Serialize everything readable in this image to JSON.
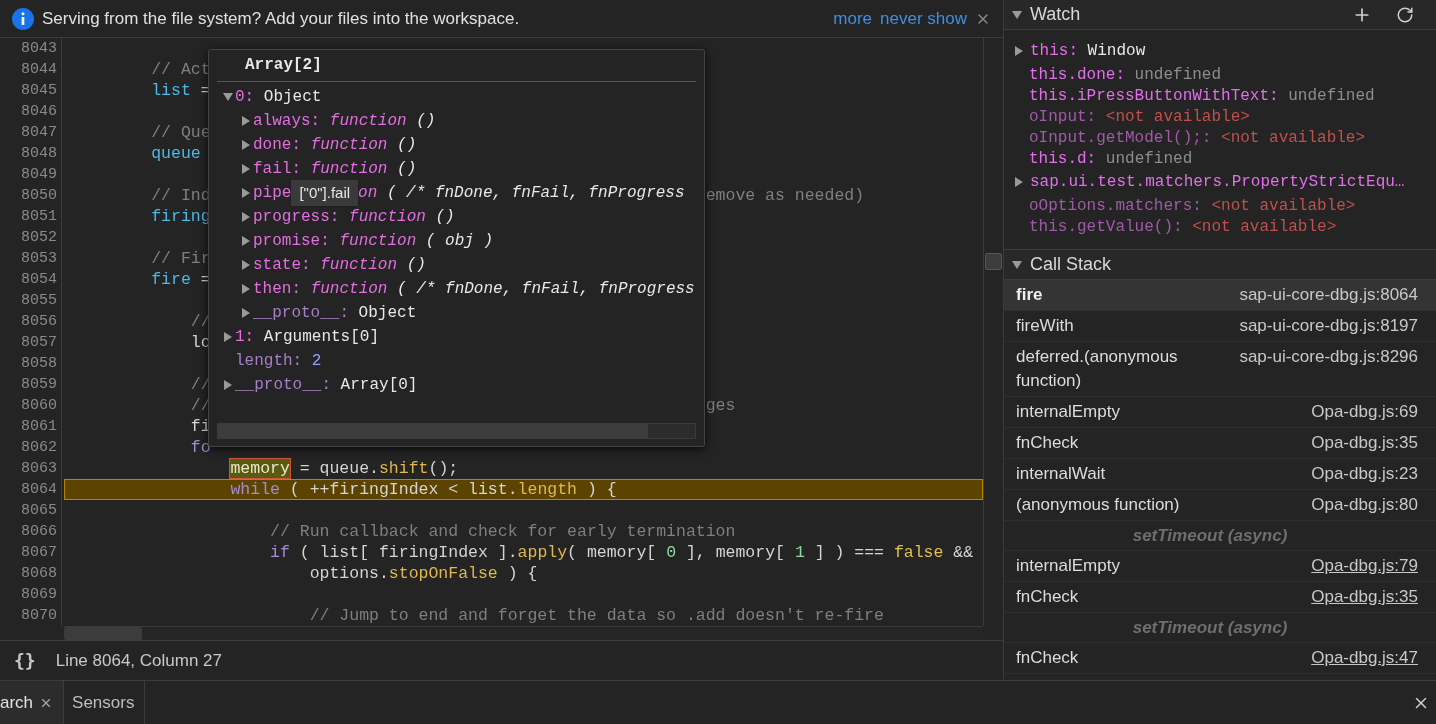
{
  "banner": {
    "message": "Serving from the file system? Add your files into the workspace.",
    "links": [
      "more",
      "never show"
    ]
  },
  "editor": {
    "lines": [
      {
        "number": "8043",
        "current": false
      },
      {
        "number": "8044",
        "current": false,
        "parts": [
          {
            "tokens": [
              {
                "kind": "comment",
                "text": "        // Act"
              }
            ]
          }
        ]
      },
      {
        "number": "8045",
        "current": false,
        "parts": [
          {
            "tokens": [
              {
                "kind": "var",
                "text": "        list"
              },
              {
                "kind": "plain",
                "text": " ="
              }
            ]
          }
        ]
      },
      {
        "number": "8046",
        "current": false
      },
      {
        "number": "8047",
        "current": false,
        "parts": [
          {
            "tokens": [
              {
                "kind": "comment",
                "text": "        // Que"
              }
            ]
          }
        ]
      },
      {
        "number": "8048",
        "current": false,
        "parts": [
          {
            "tokens": [
              {
                "kind": "var",
                "text": "        queue"
              }
            ]
          }
        ]
      },
      {
        "number": "8049",
        "current": false
      },
      {
        "number": "8050",
        "current": false,
        "parts": [
          {
            "tokens": [
              {
                "kind": "comment",
                "text": "        // Ind"
              }
            ]
          },
          {
            "tokens": [
              {
                "kind": "comment",
                "text": "emove as needed)"
              }
            ]
          }
        ]
      },
      {
        "number": "8051",
        "current": false,
        "parts": [
          {
            "tokens": [
              {
                "kind": "var",
                "text": "        firing"
              }
            ]
          }
        ]
      },
      {
        "number": "8052",
        "current": false
      },
      {
        "number": "8053",
        "current": false,
        "parts": [
          {
            "tokens": [
              {
                "kind": "comment",
                "text": "        // Fir"
              }
            ]
          }
        ]
      },
      {
        "number": "8054",
        "current": false,
        "parts": [
          {
            "tokens": [
              {
                "kind": "var",
                "text": "        fire"
              },
              {
                "kind": "plain",
                "text": " ="
              }
            ]
          }
        ]
      },
      {
        "number": "8055",
        "current": false
      },
      {
        "number": "8056",
        "current": false,
        "parts": [
          {
            "tokens": [
              {
                "kind": "comment",
                "text": "            //"
              }
            ]
          }
        ]
      },
      {
        "number": "8057",
        "current": false,
        "parts": [
          {
            "tokens": [
              {
                "kind": "plain",
                "text": "            lo"
              }
            ]
          }
        ]
      },
      {
        "number": "8058",
        "current": false
      },
      {
        "number": "8059",
        "current": false,
        "parts": [
          {
            "tokens": [
              {
                "kind": "comment",
                "text": "            //"
              }
            ]
          }
        ]
      },
      {
        "number": "8060",
        "current": false,
        "parts": [
          {
            "tokens": [
              {
                "kind": "comment",
                "text": "            //"
              }
            ]
          },
          {
            "tokens": [
              {
                "kind": "comment",
                "text": "ges"
              }
            ]
          }
        ]
      },
      {
        "number": "8061",
        "current": false,
        "parts": [
          {
            "tokens": [
              {
                "kind": "plain",
                "text": "            fi"
              }
            ]
          }
        ]
      },
      {
        "number": "8062",
        "current": false,
        "parts": [
          {
            "tokens": [
              {
                "kind": "keyword",
                "text": "            fo"
              }
            ]
          }
        ]
      },
      {
        "number": "8063",
        "current": false,
        "parts": [
          {
            "tokens": [
              {
                "kind": "match",
                "text": "                memory"
              },
              {
                "kind": "plain",
                "text": " = queue."
              },
              {
                "kind": "prop",
                "text": "shift"
              },
              {
                "kind": "plain",
                "text": "();"
              }
            ]
          }
        ]
      },
      {
        "number": "8064",
        "current": true,
        "parts": [
          {
            "tokens": [
              {
                "kind": "keyword",
                "text": "                while"
              },
              {
                "kind": "plain",
                "text": " ( ++firingIndex < list."
              },
              {
                "kind": "prop",
                "text": "length"
              },
              {
                "kind": "plain",
                "text": " ) {"
              }
            ]
          }
        ]
      },
      {
        "number": "8065",
        "current": false
      },
      {
        "number": "8066",
        "current": false,
        "parts": [
          {
            "tokens": [
              {
                "kind": "comment",
                "text": "                    // Run callback and check for early termination"
              }
            ]
          }
        ]
      },
      {
        "number": "8067",
        "current": false,
        "parts": [
          {
            "tokens": [
              {
                "kind": "keyword",
                "text": "                    if"
              },
              {
                "kind": "plain",
                "text": " ( list[ firingIndex ]."
              },
              {
                "kind": "prop",
                "text": "apply"
              },
              {
                "kind": "plain",
                "text": "( memory[ "
              },
              {
                "kind": "number",
                "text": "0"
              },
              {
                "kind": "plain",
                "text": " ], memory[ "
              },
              {
                "kind": "number",
                "text": "1"
              },
              {
                "kind": "plain",
                "text": " ] ) === "
              },
              {
                "kind": "bool",
                "text": "false"
              },
              {
                "kind": "plain",
                "text": " &&"
              }
            ]
          }
        ]
      },
      {
        "number": "8068",
        "current": false,
        "parts": [
          {
            "tokens": [
              {
                "kind": "plain",
                "text": "                        options."
              },
              {
                "kind": "prop",
                "text": "stopOnFalse"
              },
              {
                "kind": "plain",
                "text": " ) {"
              }
            ]
          }
        ]
      },
      {
        "number": "8069",
        "current": false
      },
      {
        "number": "8070",
        "current": false,
        "parts": [
          {
            "tokens": [
              {
                "kind": "comment",
                "text": "                        // Jump to end and forget the data so .add doesn't re-fire"
              }
            ]
          }
        ]
      }
    ],
    "popover": {
      "title": "Array[2]",
      "tree": [
        {
          "name": "0:",
          "kind": "node",
          "expanded": true,
          "enumerable": true,
          "value": "Object",
          "children": [
            {
              "name": "always:",
              "kind": "node",
              "expanded": false,
              "enumerable": true,
              "keyword": "function",
              "params": "()"
            },
            {
              "name": "done:",
              "kind": "node",
              "expanded": false,
              "enumerable": true,
              "keyword": "function",
              "params": "()"
            },
            {
              "name": "fail:",
              "kind": "node",
              "expanded": false,
              "enumerable": true,
              "keyword": "function",
              "params": "()"
            },
            {
              "name": "pipe",
              "kind": "node",
              "expanded": false,
              "enumerable": true,
              "tooltip": "[\"0\"].fail",
              "keyword": "on",
              "params": "( /* fnDone, fnFail, fnProgress"
            },
            {
              "name": "progress:",
              "kind": "node",
              "expanded": false,
              "enumerable": true,
              "keyword": "function",
              "params": "()"
            },
            {
              "name": "promise:",
              "kind": "node",
              "expanded": false,
              "enumerable": true,
              "keyword": "function",
              "params": "( obj )"
            },
            {
              "name": "state:",
              "kind": "node",
              "expanded": false,
              "enumerable": true,
              "keyword": "function",
              "params": "()"
            },
            {
              "name": "then:",
              "kind": "node",
              "expanded": false,
              "enumerable": true,
              "keyword": "function",
              "params": "( /* fnDone, fnFail, fnProgress"
            },
            {
              "name": "__proto__:",
              "kind": "node",
              "expanded": false,
              "enumerable": false,
              "value": "Object"
            }
          ]
        },
        {
          "name": "1:",
          "kind": "node",
          "expanded": false,
          "enumerable": true,
          "value": "Arguments[0]"
        },
        {
          "name": "length:",
          "kind": "leaf",
          "enumerable": false,
          "value": "2"
        },
        {
          "name": "__proto__:",
          "kind": "node",
          "expanded": false,
          "enumerable": false,
          "value": "Array[0]"
        }
      ]
    }
  },
  "status_bar": {
    "format_button": "{}",
    "position": "Line 8064, Column 27"
  },
  "watch": {
    "title": "Watch",
    "expanded": true,
    "items": [
      {
        "kind": "object",
        "expression": "this:",
        "value": "Window",
        "expanded": false
      },
      {
        "kind": "value",
        "expression": "this.done:",
        "value": "undefined"
      },
      {
        "kind": "value",
        "expression": "this.iPressButtonWithText:",
        "value": "undefined"
      },
      {
        "kind": "unavailable",
        "expression": "oInput:",
        "value": "<not available>"
      },
      {
        "kind": "unavailable",
        "expression": "oInput.getModel();:",
        "value": "<not available>"
      },
      {
        "kind": "value",
        "expression": "this.d:",
        "value": "undefined"
      },
      {
        "kind": "object",
        "expression": "sap.ui.test.matchers.PropertyStrictEqu…",
        "expanded": false
      },
      {
        "kind": "unavailable",
        "expression": "oOptions.matchers:",
        "value": "<not available>"
      },
      {
        "kind": "unavailable",
        "expression": "this.getValue():",
        "value": "<not available>"
      }
    ]
  },
  "call_stack": {
    "title": "Call Stack",
    "expanded": true,
    "frames": [
      {
        "kind": "frame",
        "function": "fire",
        "location": "sap-ui-core-dbg.js:8064",
        "selected": true,
        "link": false
      },
      {
        "kind": "frame",
        "function": "fireWith",
        "location": "sap-ui-core-dbg.js:8197",
        "selected": false,
        "link": false
      },
      {
        "kind": "frame",
        "function": "deferred.(anonymous function)",
        "location": "sap-ui-core-dbg.js:8296",
        "selected": false,
        "link": false
      },
      {
        "kind": "frame",
        "function": "internalEmpty",
        "location": "Opa-dbg.js:69",
        "selected": false,
        "link": false
      },
      {
        "kind": "frame",
        "function": "fnCheck",
        "location": "Opa-dbg.js:35",
        "selected": false,
        "link": false
      },
      {
        "kind": "frame",
        "function": "internalWait",
        "location": "Opa-dbg.js:23",
        "selected": false,
        "link": false
      },
      {
        "kind": "frame",
        "function": "(anonymous function)",
        "location": "Opa-dbg.js:80",
        "selected": false,
        "link": false
      },
      {
        "kind": "async",
        "label": "setTimeout (async)"
      },
      {
        "kind": "frame",
        "function": "internalEmpty",
        "location": "Opa-dbg.js:79",
        "selected": false,
        "link": true
      },
      {
        "kind": "frame",
        "function": "fnCheck",
        "location": "Opa-dbg.js:35",
        "selected": false,
        "link": true
      },
      {
        "kind": "async",
        "label": "setTimeout (async)"
      },
      {
        "kind": "frame",
        "function": "fnCheck",
        "location": "Opa-dbg.js:47",
        "selected": false,
        "link": true
      }
    ]
  },
  "drawer_tabs": [
    {
      "label": "arch",
      "selected": true,
      "closable": true
    },
    {
      "label": "Sensors",
      "selected": false,
      "closable": false
    }
  ]
}
